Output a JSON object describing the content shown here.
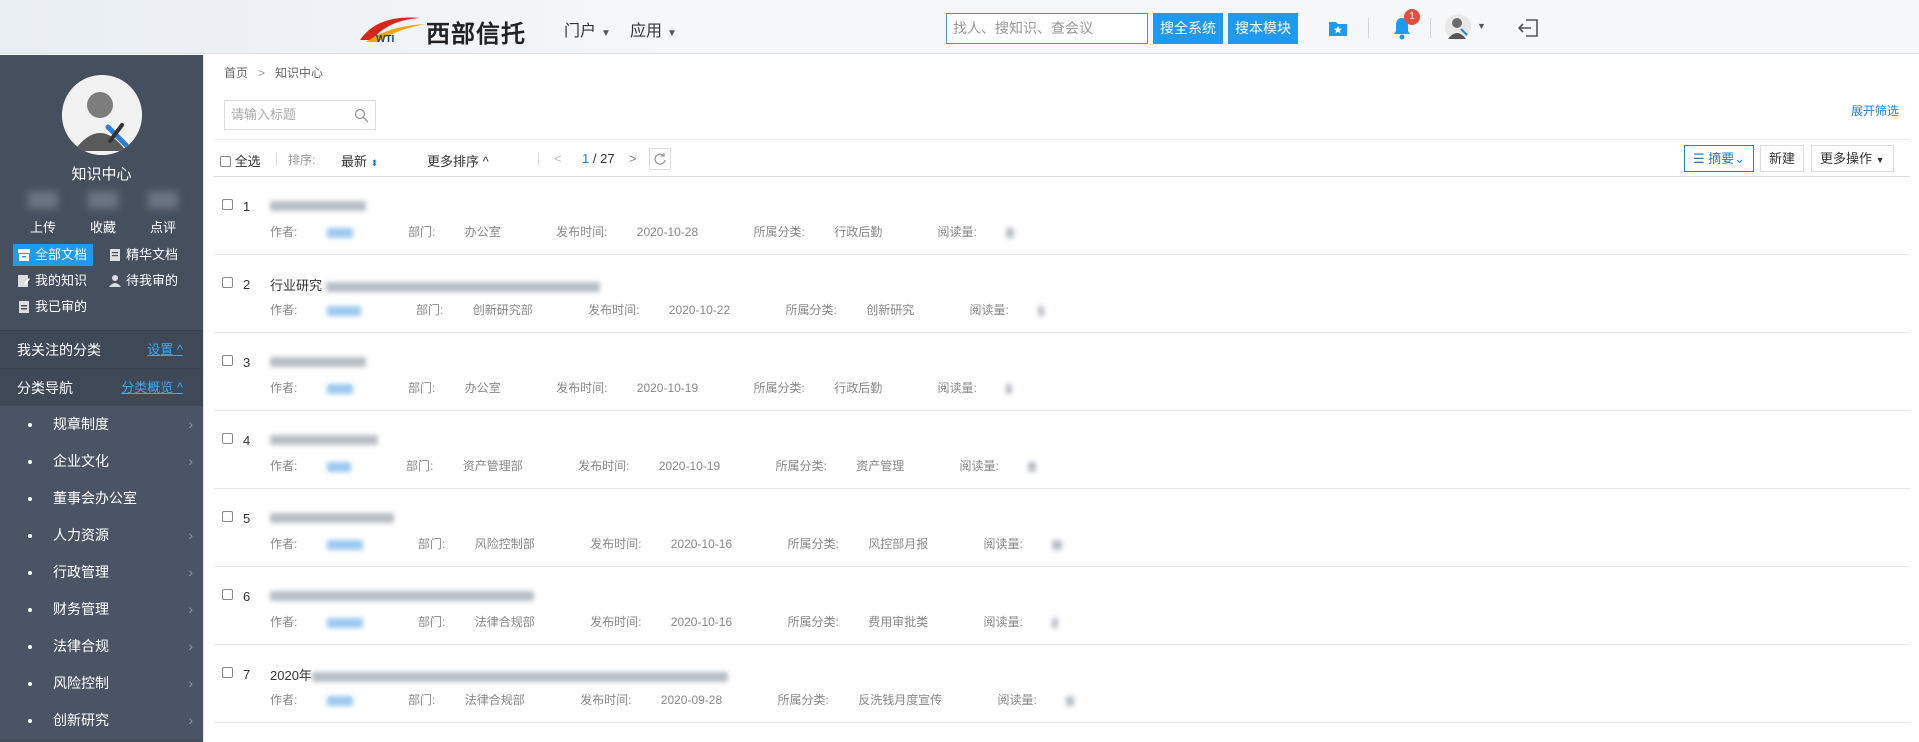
{
  "header": {
    "logo_text": "西部信托",
    "logo_mark": "WTI",
    "nav": [
      {
        "label": "门户"
      },
      {
        "label": "应用"
      }
    ],
    "search_placeholder": "找人、搜知识、查会议",
    "search_all_label": "搜全系统",
    "search_module_label": "搜本模块",
    "notification_count": "1"
  },
  "sidebar": {
    "title": "知识中心",
    "stats": [
      "上传",
      "收藏",
      "点评"
    ],
    "links": [
      {
        "label": "全部文档",
        "icon": "archive-icon",
        "active": true
      },
      {
        "label": "精华文档",
        "icon": "bookmark-doc-icon",
        "active": false
      },
      {
        "label": "我的知识",
        "icon": "edit-doc-icon",
        "active": false
      },
      {
        "label": "待我审的",
        "icon": "user-icon",
        "active": false
      },
      {
        "label": "我已审的",
        "icon": "approved-icon",
        "active": false
      }
    ],
    "followed_section": {
      "label": "我关注的分类",
      "action": "设置"
    },
    "category_section": {
      "label": "分类导航",
      "action": "分类概览"
    },
    "categories": [
      {
        "label": "规章制度",
        "has_children": true
      },
      {
        "label": "企业文化",
        "has_children": true
      },
      {
        "label": "董事会办公室",
        "has_children": false
      },
      {
        "label": "人力资源",
        "has_children": true
      },
      {
        "label": "行政管理",
        "has_children": true
      },
      {
        "label": "财务管理",
        "has_children": true
      },
      {
        "label": "法律合规",
        "has_children": true
      },
      {
        "label": "风险控制",
        "has_children": true
      },
      {
        "label": "创新研究",
        "has_children": true
      }
    ]
  },
  "main": {
    "breadcrumb": [
      "首页",
      "知识中心"
    ],
    "title_search_placeholder": "请输入标题",
    "expand_filter": "展开筛选",
    "toolbar": {
      "select_all": "全选",
      "sort_label": "排序:",
      "sort_value": "最新",
      "more_sort": "更多排序",
      "page_current": "1",
      "page_total": "/ 27",
      "view_mode": "摘要",
      "new_label": "新建",
      "more_actions": "更多操作"
    },
    "meta_labels": {
      "author": "作者:",
      "dept": "部门:",
      "published": "发布时间:",
      "category": "所属分类:",
      "reads": "阅读量:"
    },
    "documents": [
      {
        "num": "1",
        "title_prefix": "",
        "dept": "办公室",
        "date": "2020-10-28",
        "category": "行政后勤"
      },
      {
        "num": "2",
        "title_prefix": "行业研究",
        "dept": "创新研究部",
        "date": "2020-10-22",
        "category": "创新研究"
      },
      {
        "num": "3",
        "title_prefix": "",
        "dept": "办公室",
        "date": "2020-10-19",
        "category": "行政后勤"
      },
      {
        "num": "4",
        "title_prefix": "",
        "dept": "资产管理部",
        "date": "2020-10-19",
        "category": "资产管理"
      },
      {
        "num": "5",
        "title_prefix": "",
        "dept": "风险控制部",
        "date": "2020-10-16",
        "category": "风控部月报"
      },
      {
        "num": "6",
        "title_prefix": "",
        "dept": "法律合规部",
        "date": "2020-10-16",
        "category": "费用审批类"
      },
      {
        "num": "7",
        "title_prefix": "2020年",
        "dept": "法律合规部",
        "date": "2020-09-28",
        "category": "反洗钱月度宣传"
      }
    ]
  }
}
